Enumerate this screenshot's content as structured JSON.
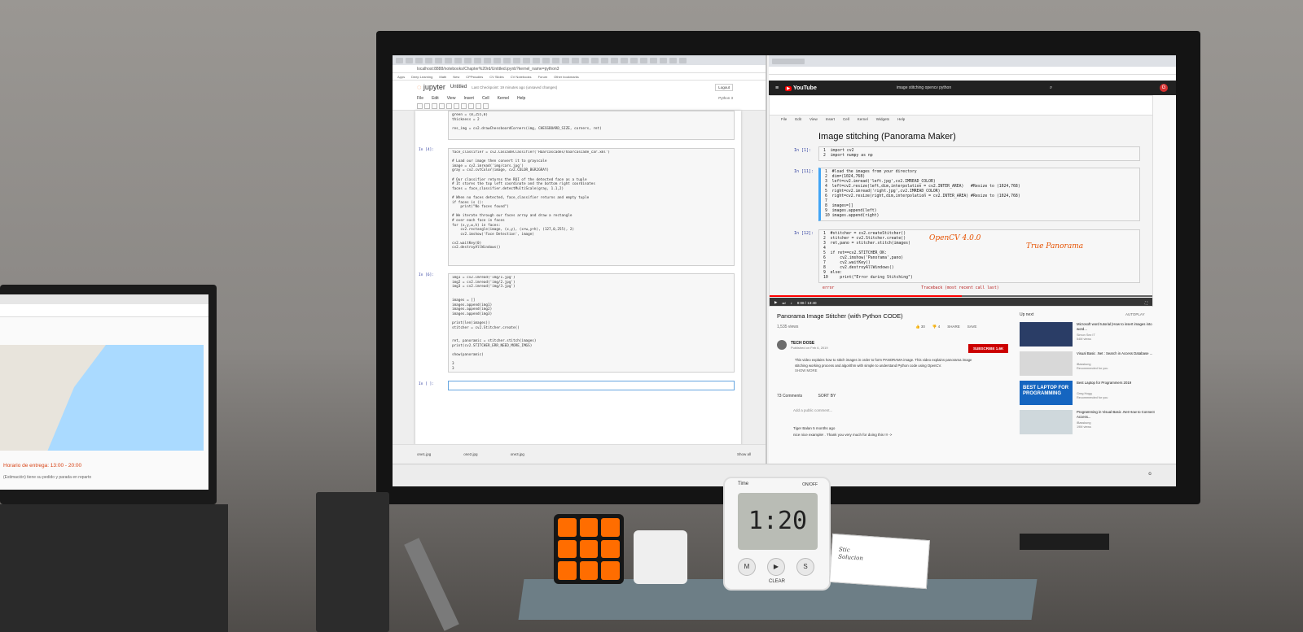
{
  "jupyter": {
    "logo": "jupyter",
    "notebook_title": "Untitled",
    "checkpoint": "Last Checkpoint: 19 minutes ago  (unsaved changes)",
    "logout": "Logout",
    "kernel": "Python 3",
    "menu": [
      "File",
      "Edit",
      "View",
      "Insert",
      "Cell",
      "Kernel",
      "Help"
    ],
    "address": "localhost:8888/notebooks/Chapter%20rd/Untitled.ipynb?kernel_name=python3",
    "bookmarks": [
      "Apps",
      "Deep Learning",
      "Math",
      "New",
      "CPPstudies",
      "CV Slides",
      "CV Notebooks",
      "Forum",
      "Other bookmarks"
    ],
    "cell1_code": "green = (0,255,0)\nthickness = 2\n\nres_img = cv2.drawChessboardCorners(img, CHESSBOARD_SIZE, corners, ret)",
    "cell2_prompt": "In [4]:",
    "cell2_code": "face_classifier = cv2.CascadeClassifier('Haarcascades/haarcascade_car.xml')\n\n# Load our image then convert it to grayscale\nimage = cv2.imread('img/cars.jpg')\ngray = cv2.cvtColor(image, cv2.COLOR_BGR2GRAY)\n\n# Our classifier returns the ROI of the detected face as a tuple\n# It stores the top left coordinate and the bottom right coordinates\nfaces = face_classifier.detectMultiScale(gray, 1.1,2)\n\n# When no faces detected, face_classifier returns and empty tuple\nif faces is ():\n    print(\"No faces found\")\n\n# We iterate through our faces array and draw a rectangle\n# over each face in faces\nfor (x,y,w,h) in faces:\n    cv2.rectangle(image, (x,y), (x+w,y+h), (127,0,255), 2)\n    cv2.imshow('Face Detection', image)\n\ncv2.waitKey(0)\ncv2.destroyAllWindows()",
    "cell3_prompt": "In [6]:",
    "cell3_code": "img1 = cv2.imread('img/1.jpg')\nimg2 = cv2.imread('img/2.jpg')\nimg3 = cv2.imread('img/3.jpg')\n\n\nimages = []\nimages.append(img1)\nimages.append(img2)\nimages.append(img3)\n\nprint(len(images))\nstitcher = cv2.Stitcher.create()\n\n\nret, panoramic = stitcher.stitch(images)\nprint(cv2.STITCHER_ERR_NEED_MORE_IMGS)\n\nshow(panoramic)\n\n3\n3",
    "cell4_prompt": "In [ ]:",
    "taskbar_files": [
      "one1.jpg",
      "one2.jpg",
      "one3.jpg"
    ],
    "show_all": "Show all"
  },
  "youtube": {
    "logo": "YouTube",
    "search": "image stitching opencv python",
    "avatar_letter": "G",
    "video_heading": "Image stitching (Panorama Maker)",
    "video_menu": [
      "File",
      "Edit",
      "View",
      "Insert",
      "Cell",
      "Kernel",
      "Widgets",
      "Help"
    ],
    "v_cell1_prompt": "In [1]:",
    "v_cell1_code": "1  import cv2\n2  import numpy as np",
    "v_cell2_prompt": "In [11]:",
    "v_cell2_code": "1  #load the images from your directory\n2  dim=(1024,768)\n3  left=cv2.imread('left.jpg',cv2.IMREAD_COLOR)\n4  left=cv2.resize(left,dim,interpolation = cv2.INTER_AREA)   #Resize to (1024,768)\n5  right=cv2.imread('right.jpg',cv2.IMREAD_COLOR)\n6  right=cv2.resize(right,dim,interpolation = cv2.INTER_AREA) #Resize to (1024,768)\n7\n8  images=[]\n9  images.append(left)\n10 images.append(right)",
    "v_cell3_prompt": "In [12]:",
    "v_cell3_code": "1  #stitcher = cv2.createStitcher()\n2  stitcher = cv2.Stitcher.create()\n3  ret,pano = stitcher.stitch(images)\n4\n5  if ret==cv2.STITCHER_OK:\n6      cv2.imshow('Panorama',pano)\n7      cv2.waitKey()\n8      cv2.destroyAllWindows()\n9  else:\n10     print(\"Error during Stitching\")",
    "v_error": "error                                     Traceback (most recent call last)",
    "annotation1": "OpenCV 4.0.0",
    "annotation2": "True Panorama",
    "time": "8:08 / 13:40",
    "progress": 0.5,
    "title": "Panorama Image Stitcher (with Python CODE)",
    "views": "1,535 views",
    "likes": "30",
    "dislikes": "4",
    "share": "SHARE",
    "save": "SAVE",
    "channel": "TECH DOSE",
    "published": "Published on Feb 6, 2019",
    "subscribe": "SUBSCRIBE 1.6K",
    "description": "This video explains how to stitch images in order to form PANORAMA image. This video explains panorama image stitching working process and algorithm with simple to understand Python code using OpenCV.",
    "show_more": "SHOW MORE",
    "comments": "73 Comments",
    "sort_by": "SORT BY",
    "add_comment": "Add a public comment...",
    "comment_author": "Tiger Balan 5 months ago",
    "comment_text": "nice nice example! . Thank you very much for doing this !!! ->",
    "up_next": "Up next",
    "autoplay": "AUTOPLAY",
    "recommendations": [
      {
        "title": "Microsoft word tutorial |How to insert images into word...",
        "meta": "Simon Sez IT\n54M views"
      },
      {
        "title": "Visual Basic .Net : Search in Access Database ...",
        "meta": "iBasskung\nRecommended for you"
      },
      {
        "title": "Best Laptop for Programmers 2019",
        "meta": "Greg Hogg\nRecommended for you",
        "thumb": "BEST LAPTOP FOR PROGRAMMING"
      },
      {
        "title": "Programming in Visual Basic .Net How to Connect Access...",
        "meta": "iBasskung\n19M views"
      }
    ]
  },
  "laptop": {
    "delivery_time": "Horario de entrega: 13:00 - 20:00",
    "note": "(Estimación) tiene su pedido y parada en reparto"
  },
  "timer": {
    "brand": "Time",
    "top_label": "ON/OFF",
    "display": "1:20",
    "buttons": [
      "M",
      "S"
    ],
    "clear": "CLEAR"
  },
  "paper_note": "Stic\nSolucion"
}
